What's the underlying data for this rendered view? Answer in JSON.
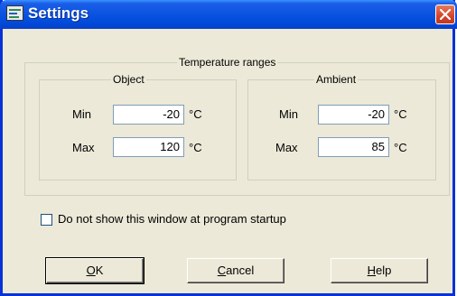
{
  "window": {
    "title": "Settings",
    "close_icon": "close-icon",
    "app_icon": "settings-app-icon"
  },
  "temperature_ranges": {
    "legend": "Temperature ranges",
    "object": {
      "legend": "Object",
      "min_label": "Min",
      "min_value": "-20",
      "max_label": "Max",
      "max_value": "120",
      "unit": "°C"
    },
    "ambient": {
      "legend": "Ambient",
      "min_label": "Min",
      "min_value": "-20",
      "max_label": "Max",
      "max_value": "85",
      "unit": "°C"
    }
  },
  "startup_checkbox": {
    "label": "Do not show this window at program startup",
    "checked": false
  },
  "buttons": {
    "ok": {
      "mnemonic": "O",
      "rest": "K"
    },
    "cancel": {
      "mnemonic": "C",
      "rest": "ancel"
    },
    "help": {
      "mnemonic": "H",
      "rest": "elp"
    }
  },
  "colors": {
    "titlebar": "#0a53e0",
    "close_button": "#d2452a",
    "dialog_face": "#ece9d8"
  }
}
